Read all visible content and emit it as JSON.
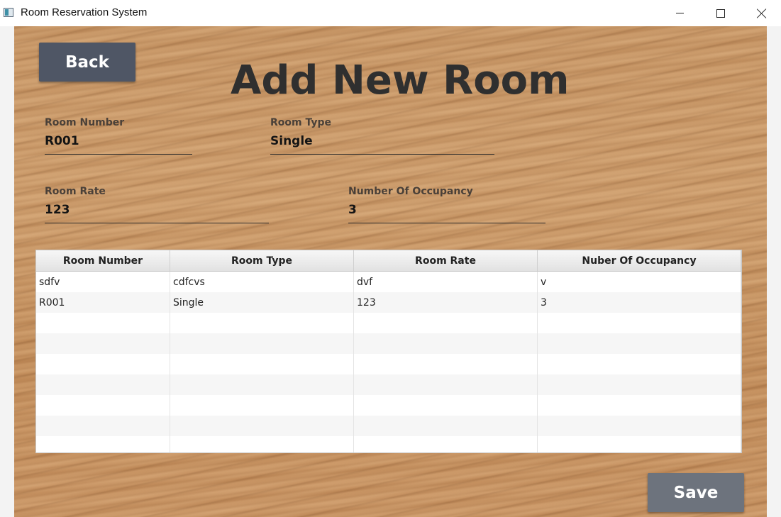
{
  "window": {
    "title": "Room Reservation System",
    "icon": "app-window-icon",
    "controls": [
      "minimize-icon",
      "maximize-icon",
      "close-icon"
    ]
  },
  "page": {
    "title": "Add New Room",
    "back_label": "Back",
    "save_label": "Save"
  },
  "form": {
    "room_number": {
      "label": "Room Number",
      "value": "R001"
    },
    "room_type": {
      "label": "Room Type",
      "value": "Single"
    },
    "room_rate": {
      "label": "Room Rate",
      "value": "123"
    },
    "occupancy": {
      "label": "Number Of Occupancy",
      "value": "3"
    }
  },
  "table": {
    "columns": [
      "Room Number",
      "Room Type",
      "Room Rate",
      "Nuber Of Occupancy"
    ],
    "rows": [
      [
        "sdfv",
        "cdfcvs",
        "dvf",
        "v"
      ],
      [
        "R001",
        "Single",
        "123",
        "3"
      ]
    ]
  },
  "colors": {
    "back_button": "#4f5665",
    "save_button": "#6d737d",
    "title_text": "#2f2f2f",
    "wood_background": "#c89563"
  }
}
